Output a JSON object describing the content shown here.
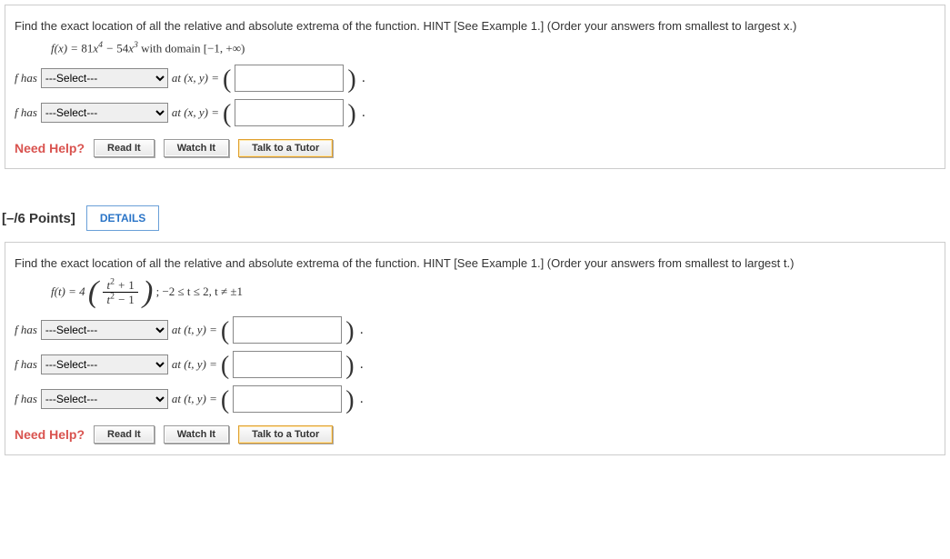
{
  "q1": {
    "prompt": "Find the exact location of all the relative and absolute extrema of the function. HINT [See Example 1.] (Order your answers from smallest to largest x.)",
    "func_prefix": "f(x) = ",
    "func_html": "81x⁴ − 54x³",
    "domain_text": " with domain [−1, +∞)",
    "rows": [
      {
        "prefix": "f has ",
        "select_placeholder": "---Select---",
        "at": " at (x, y) = "
      },
      {
        "prefix": "f has ",
        "select_placeholder": "---Select---",
        "at": " at (x, y) = "
      }
    ]
  },
  "section": {
    "points": "[–/6 Points]",
    "details": "DETAILS"
  },
  "q2": {
    "prompt": "Find the exact location of all the relative and absolute extrema of the function. HINT [See Example 1.] (Order your answers from smallest to largest t.)",
    "func_prefix": "f(t) = 4",
    "frac_num": "t² + 1",
    "frac_den": "t² − 1",
    "domain_text": ";  −2 ≤ t ≤ 2, t ≠ ±1",
    "rows": [
      {
        "prefix": "f has ",
        "select_placeholder": "---Select---",
        "at": " at (t, y) = "
      },
      {
        "prefix": "f has ",
        "select_placeholder": "---Select---",
        "at": " at (t, y) = "
      },
      {
        "prefix": "f has ",
        "select_placeholder": "---Select---",
        "at": " at (t, y) = "
      }
    ]
  },
  "help": {
    "label": "Need Help?",
    "read": "Read It",
    "watch": "Watch It",
    "tutor": "Talk to a Tutor"
  }
}
